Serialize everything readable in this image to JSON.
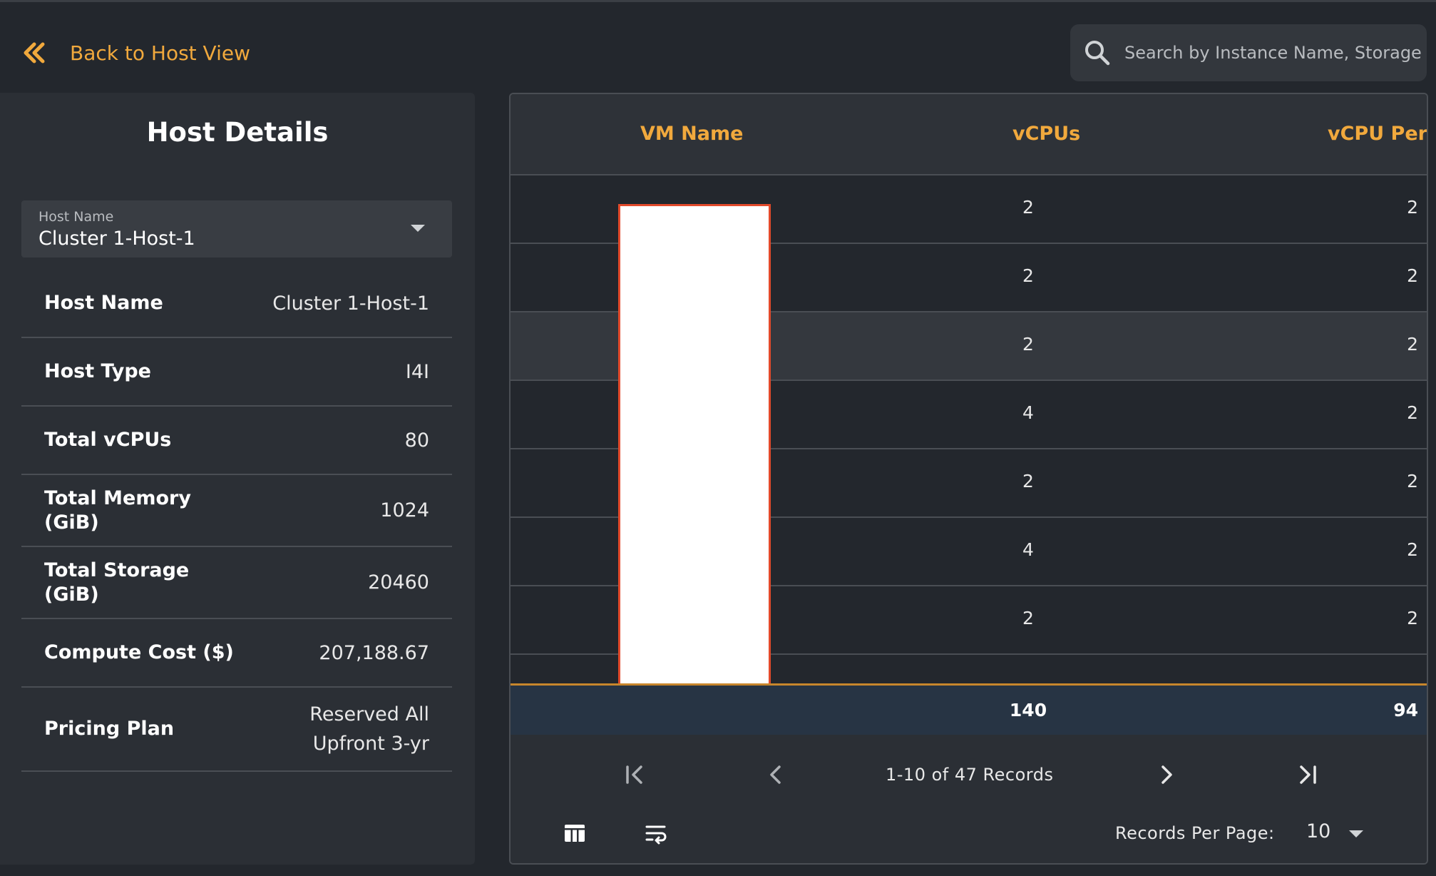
{
  "header": {
    "back_label": "Back to Host View",
    "search_placeholder": "Search by Instance Name, Storage"
  },
  "host_details": {
    "title": "Host Details",
    "selector": {
      "label": "Host Name",
      "value": "Cluster 1-Host-1"
    },
    "rows": [
      {
        "key": "Host Name",
        "value": "Cluster 1-Host-1"
      },
      {
        "key": "Host Type",
        "value": "I4I"
      },
      {
        "key": "Total vCPUs",
        "value": "80"
      },
      {
        "key": "Total Memory (GiB)",
        "value": "1024"
      },
      {
        "key": "Total Storage (GiB)",
        "value": "20460"
      },
      {
        "key": "Compute Cost ($)",
        "value": "207,188.67"
      },
      {
        "key": "Pricing Plan",
        "value": "Reserved All Upfront 3-yr"
      }
    ]
  },
  "table": {
    "columns": [
      "VM Name",
      "vCPUs",
      "vCPU Per"
    ],
    "rows": [
      {
        "vm_name": "",
        "vcpus": "2",
        "vcpu_per": "2"
      },
      {
        "vm_name": "",
        "vcpus": "2",
        "vcpu_per": "2"
      },
      {
        "vm_name": "",
        "vcpus": "2",
        "vcpu_per": "2"
      },
      {
        "vm_name": "",
        "vcpus": "4",
        "vcpu_per": "2"
      },
      {
        "vm_name": "",
        "vcpus": "2",
        "vcpu_per": "2"
      },
      {
        "vm_name": "",
        "vcpus": "4",
        "vcpu_per": "2"
      },
      {
        "vm_name": "",
        "vcpus": "2",
        "vcpu_per": "2"
      }
    ],
    "totals": {
      "vcpus": "140",
      "vcpu_per": "94"
    }
  },
  "pagination": {
    "records_text": "1-10 of 47 Records",
    "records_per_page_label": "Records Per Page:",
    "records_per_page_value": "10"
  },
  "colors": {
    "accent": "#f1a93d",
    "background": "#23272d",
    "panel": "#2b2f35",
    "footer_total": "#273444",
    "redaction_border": "#e24a2b"
  },
  "icons": [
    "double-chevron-left-icon",
    "search-icon",
    "dropdown-caret-icon",
    "first-page-icon",
    "previous-page-icon",
    "next-page-icon",
    "last-page-icon",
    "column-settings-icon",
    "wrap-text-icon"
  ]
}
